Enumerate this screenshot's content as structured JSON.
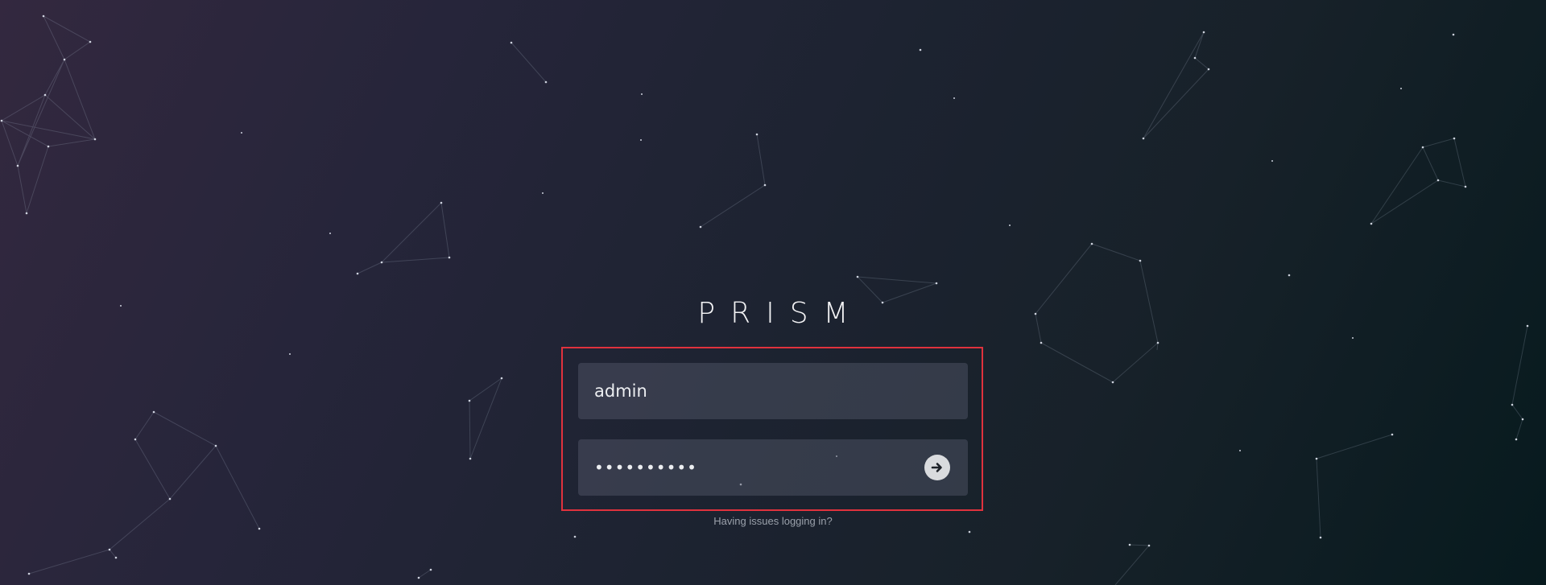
{
  "app": {
    "logo_text": "PRISM"
  },
  "login": {
    "username_value": "admin",
    "password_value": "••••••••••",
    "submit_icon": "arrow-right-icon",
    "help_text": "Having issues logging in?"
  },
  "colors": {
    "highlight_border": "#e0323d",
    "field_background": "#3a3f4c",
    "submit_button": "#d9dbde"
  },
  "background": {
    "style": "dark gradient with constellation network lines and dots"
  }
}
